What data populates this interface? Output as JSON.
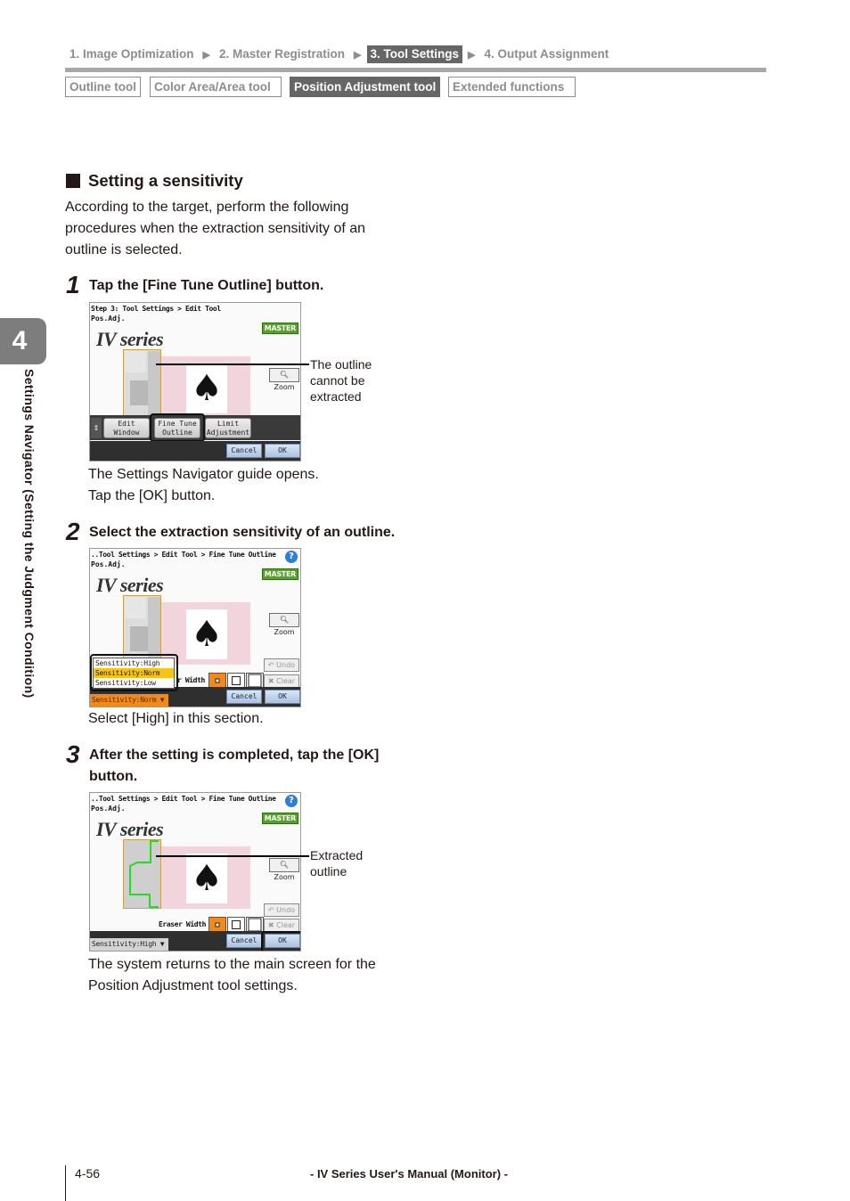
{
  "breadcrumb": {
    "steps": [
      {
        "label": "1. Image Optimization",
        "active": false
      },
      {
        "label": "2. Master Registration",
        "active": false
      },
      {
        "label": "3. Tool Settings",
        "active": true
      },
      {
        "label": "4. Output Assignment",
        "active": false
      }
    ],
    "separator_icon": "triangle-right-icon"
  },
  "tool_tabs": [
    {
      "label": "Outline tool",
      "active": false
    },
    {
      "label": "Color Area/Area tool",
      "active": false
    },
    {
      "label": "Position Adjustment tool",
      "active": true
    },
    {
      "label": "Extended functions",
      "active": false
    }
  ],
  "chapter": {
    "number": "4",
    "title": "Settings Navigator (Setting the Judgment Condition)"
  },
  "section": {
    "title": "Setting a sensitivity",
    "intro": "According to the target, perform the following procedures when the extraction sensitivity of an outline is selected."
  },
  "steps": [
    {
      "number": "1",
      "heading": "Tap the [Fine Tune Outline] button.",
      "notes": [
        "The Settings Navigator guide opens.",
        "Tap the [OK] button."
      ],
      "callout": "The outline cannot be extracted",
      "screen": {
        "breadcrumb": "Step 3: Tool Settings > Edit Tool",
        "subtitle": "Pos.Adj.",
        "logo": "IV series",
        "badge": "MASTER",
        "zoom": "Zoom",
        "tools": [
          "Edit Window",
          "Fine Tune Outline",
          "Limit Adjustment"
        ],
        "cancel": "Cancel",
        "ok": "OK",
        "highlighted": "Fine Tune Outline"
      }
    },
    {
      "number": "2",
      "heading": "Select the extraction sensitivity of an outline.",
      "notes": [
        "Select [High] in this section."
      ],
      "screen": {
        "breadcrumb": "..Tool Settings > Edit Tool > Fine Tune Outline",
        "subtitle": "Pos.Adj.",
        "logo": "IV series",
        "badge": "MASTER",
        "help": "?",
        "zoom": "Zoom",
        "undo": "Undo",
        "clear": "Clear",
        "eraser_label": "r Width",
        "sensitivity_options": [
          "Sensitivity:High",
          "Sensitivity:Norm",
          "Sensitivity:Low"
        ],
        "sensitivity_selected": "Sensitivity:Norm",
        "sensitivity_button": "Sensitivity:Norm ▼",
        "cancel": "Cancel",
        "ok": "OK"
      }
    },
    {
      "number": "3",
      "heading": "After the setting is completed, tap the [OK] button.",
      "notes": [
        "The system returns to the main screen for the Position Adjustment tool settings."
      ],
      "callout": "Extracted outline",
      "screen": {
        "breadcrumb": "..Tool Settings > Edit Tool > Fine Tune Outline",
        "subtitle": "Pos.Adj.",
        "logo": "IV series",
        "badge": "MASTER",
        "help": "?",
        "zoom": "Zoom",
        "undo": "Undo",
        "clear": "Clear",
        "eraser_label": "Eraser Width",
        "sensitivity_button": "Sensitivity:High ▼",
        "cancel": "Cancel",
        "ok": "OK",
        "highlighted": "OK"
      }
    }
  ],
  "colors": {
    "active_tab": "#666666",
    "master_badge": "#5aa02c",
    "sensitivity_orange": "#f08a1c",
    "selected_option": "#f6c416",
    "outline_green": "#22dd22"
  },
  "footer": {
    "page": "4-56",
    "title": "- IV Series User's Manual (Monitor) -"
  }
}
